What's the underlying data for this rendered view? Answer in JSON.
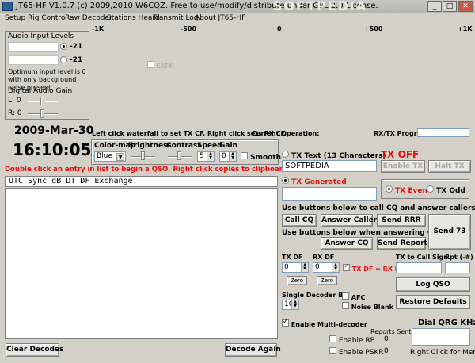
{
  "title": "JT65-HF V1.0.7 (c) 2009,2010 W6CQZ.  Free to use/modify/distribute under GPL 2.0 License.",
  "watermark": "SOFTPEDIA",
  "menu": [
    "Setup",
    "Rig Control",
    "Raw Decoder",
    "Stations Heard",
    "Transmit Log",
    "About JT65-HF"
  ],
  "ruler": [
    "-1K",
    "-500",
    "0",
    "+500",
    "+1K"
  ],
  "audio": {
    "title": "Audio Input Levels",
    "left_value": "-21",
    "right_value": "-21",
    "hint": "Optimum input level is 0 with only background noise present.",
    "gain_title": "Digital Audio Gain",
    "gain_l": "L: 0",
    "gain_r": "R: 0"
  },
  "eatx_label": "EATX",
  "date": "2009-Mar-30",
  "time": "16:10:05",
  "waterfall_hint": "Left click waterfall to set TX CF, Right click sets RX CF.",
  "current_operation": "Current Operation:",
  "rxtx_progress": "RX/TX Progress",
  "controls": {
    "colormap_label": "Color-map",
    "colormap_value": "Blue",
    "brightness_label": "Brightness",
    "contrast_label": "Contrast",
    "speed_label": "Speed",
    "speed_value": "5",
    "gain_label": "Gain",
    "gain_value": "0",
    "smooth_label": "Smooth"
  },
  "double_click_hint": "Double click an entry in list to begin a QSO.  Right click copies to clipboard.",
  "list_header": "UTC Sync dB  DT    DF        Exchange",
  "tx": {
    "text_label": "TX Text (13 Characters)",
    "text_value": "SOFTPEDIA",
    "generated_label": "TX Generated",
    "status": "TX OFF",
    "enable_tx": "Enable TX",
    "halt_tx": "Halt TX",
    "tx_even": "TX Even",
    "tx_odd": "TX Odd"
  },
  "cq": {
    "hint_call": "Use buttons below to call CQ and answer callers.",
    "call_cq": "Call CQ",
    "answer_caller": "Answer Caller",
    "send_rrr": "Send RRR",
    "hint_answer": "Use buttons below when answering CQ.",
    "answer_cq": "Answer CQ",
    "send_report": "Send Report",
    "send_73": "Send 73"
  },
  "df": {
    "tx_df_label": "TX DF",
    "rx_df_label": "RX DF",
    "tx_df_value": "0",
    "rx_df_value": "0",
    "zero": "Zero",
    "link_label": "TX DF = RX DF",
    "tx_call_label": "TX to Call Sign",
    "rpt_label": "Rpt (-#)"
  },
  "decoder": {
    "bw_label": "Single Decoder BW",
    "bw_value": "100",
    "afc_label": "AFC",
    "noise_blank_label": "Noise Blank",
    "log_qso": "Log QSO",
    "restore_defaults": "Restore Defaults",
    "multi_label": "Enable Multi-decoder",
    "reports_sent": "Reports Sent",
    "enable_rb": "Enable RB",
    "rb_count": "0",
    "enable_pskr": "Enable PSKR",
    "pskr_count": "0",
    "dial_qrg": "Dial QRG KHz",
    "right_click": "Right Click for Menu"
  },
  "bottom": {
    "clear_decodes": "Clear Decodes",
    "decode_again": "Decode Again"
  },
  "colors": {
    "accent_red": "#e01010",
    "tx_generated_red": "#d81818"
  }
}
